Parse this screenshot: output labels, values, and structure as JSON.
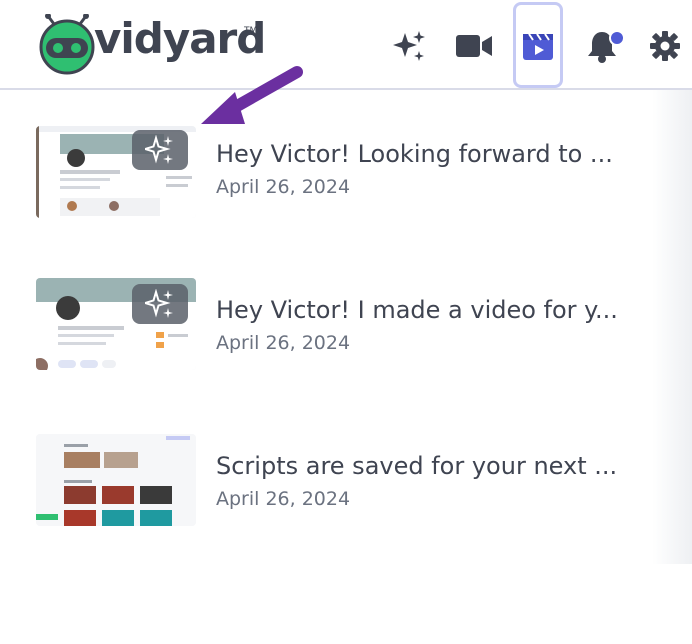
{
  "app": {
    "logo_text": "vidyard",
    "logo_tm": "TM"
  },
  "toolbar": {
    "icons": [
      "sparkles-icon",
      "video-camera-icon",
      "video-library-icon",
      "notification-bell-icon",
      "gear-icon"
    ],
    "active_icon": "video-library-icon",
    "notification_dot_color": "#4f5bd5"
  },
  "videos": [
    {
      "title": "Hey Victor! Looking forward to ...",
      "date": "April 26, 2024",
      "has_ai_badge": true
    },
    {
      "title": "Hey Victor! I made a video for y...",
      "date": "April 26, 2024",
      "has_ai_badge": true
    },
    {
      "title": "Scripts are saved for your next ...",
      "date": "April 26, 2024",
      "has_ai_badge": false
    }
  ],
  "annotation": {
    "arrow_color": "#6b2fa0"
  },
  "colors": {
    "brand_green": "#2fbf71",
    "accent": "#4f5bd5",
    "text": "#3f4451"
  }
}
